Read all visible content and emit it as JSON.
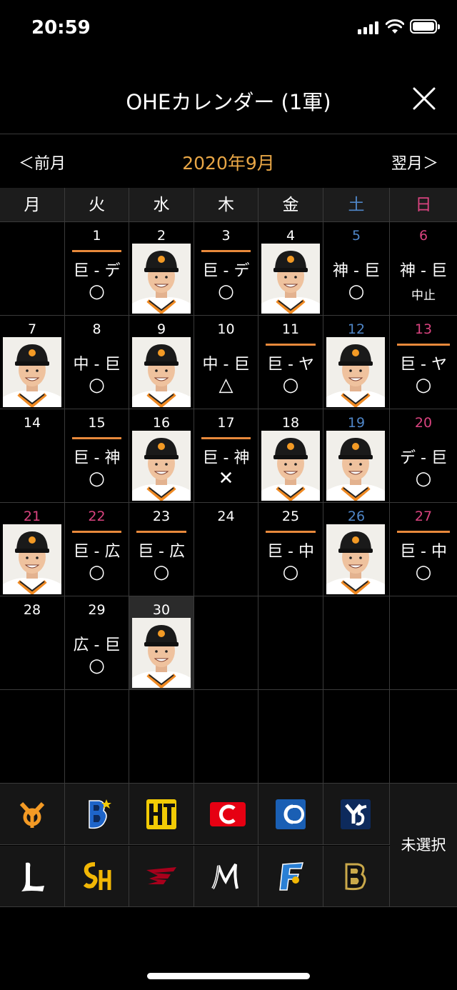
{
  "status": {
    "time": "20:59"
  },
  "header": {
    "title": "OHEカレンダー (1軍)",
    "close_icon": "close-icon"
  },
  "month_nav": {
    "prev": "＜前月",
    "month": "2020年9月",
    "next": "翌月＞"
  },
  "colors": {
    "accent": "#e8a646",
    "bar": "#e8893b",
    "saturday": "#4f86c8",
    "sunday": "#d9437f",
    "grid": "#3a3a3a"
  },
  "weekdays": [
    {
      "label": "月",
      "kind": "weekday"
    },
    {
      "label": "火",
      "kind": "weekday"
    },
    {
      "label": "水",
      "kind": "weekday"
    },
    {
      "label": "木",
      "kind": "weekday"
    },
    {
      "label": "金",
      "kind": "weekday"
    },
    {
      "label": "土",
      "kind": "sat"
    },
    {
      "label": "日",
      "kind": "sun"
    }
  ],
  "weeks": [
    [
      {
        "day": ""
      },
      {
        "day": "1",
        "matchup": "巨 - デ",
        "result": "○",
        "bar": true
      },
      {
        "day": "2",
        "photo": true
      },
      {
        "day": "3",
        "matchup": "巨 - デ",
        "result": "○",
        "bar": true
      },
      {
        "day": "4",
        "photo": true
      },
      {
        "day": "5",
        "kind": "sat",
        "matchup": "神 - 巨",
        "result": "○"
      },
      {
        "day": "6",
        "kind": "sun",
        "matchup": "神 - 巨",
        "result": "中止",
        "cancel": true
      }
    ],
    [
      {
        "day": "7",
        "photo": true
      },
      {
        "day": "8",
        "matchup": "中 - 巨",
        "result": "○"
      },
      {
        "day": "9",
        "photo": true
      },
      {
        "day": "10",
        "matchup": "中 - 巨",
        "result": "△"
      },
      {
        "day": "11",
        "matchup": "巨 - ヤ",
        "result": "○",
        "bar": true
      },
      {
        "day": "12",
        "kind": "sat",
        "photo": true
      },
      {
        "day": "13",
        "kind": "sun",
        "matchup": "巨 - ヤ",
        "result": "○",
        "bar": true
      }
    ],
    [
      {
        "day": "14"
      },
      {
        "day": "15",
        "matchup": "巨 - 神",
        "result": "○",
        "bar": true
      },
      {
        "day": "16",
        "photo": true
      },
      {
        "day": "17",
        "matchup": "巨 - 神",
        "result": "✕",
        "bar": true
      },
      {
        "day": "18",
        "photo": true
      },
      {
        "day": "19",
        "kind": "sat",
        "photo": true
      },
      {
        "day": "20",
        "kind": "sun",
        "matchup": "デ - 巨",
        "result": "○"
      }
    ],
    [
      {
        "day": "21",
        "kind": "sun",
        "photo": true
      },
      {
        "day": "22",
        "kind": "sun",
        "matchup": "巨 - 広",
        "result": "○",
        "bar": true
      },
      {
        "day": "23",
        "matchup": "巨 - 広",
        "result": "○",
        "bar": true
      },
      {
        "day": "24"
      },
      {
        "day": "25",
        "matchup": "巨 - 中",
        "result": "○",
        "bar": true
      },
      {
        "day": "26",
        "kind": "sat",
        "photo": true
      },
      {
        "day": "27",
        "kind": "sun",
        "matchup": "巨 - 中",
        "result": "○",
        "bar": true
      }
    ],
    [
      {
        "day": "28"
      },
      {
        "day": "29",
        "matchup": "広 - 巨",
        "result": "○"
      },
      {
        "day": "30",
        "photo": true,
        "today": true
      },
      {
        "day": ""
      },
      {
        "day": ""
      },
      {
        "day": ""
      },
      {
        "day": ""
      }
    ],
    [
      {
        "day": ""
      },
      {
        "day": ""
      },
      {
        "day": ""
      },
      {
        "day": ""
      },
      {
        "day": ""
      },
      {
        "day": ""
      },
      {
        "day": ""
      }
    ]
  ],
  "teams": [
    [
      {
        "name": "giants-logo",
        "color": "#f39a25"
      },
      {
        "name": "baystars-logo",
        "color": "#1e64c8"
      },
      {
        "name": "tigers-logo",
        "color": "#f2cb05"
      },
      {
        "name": "carp-logo",
        "color": "#e60012"
      },
      {
        "name": "dragons-logo",
        "color": "#1a5fb4"
      },
      {
        "name": "swallows-logo",
        "color": "#0d2a5c"
      }
    ],
    [
      {
        "name": "lions-logo",
        "color": "#ffffff"
      },
      {
        "name": "hawks-logo",
        "color": "#f2b705"
      },
      {
        "name": "eagles-logo",
        "color": "#a8001c"
      },
      {
        "name": "marines-logo",
        "color": "#ffffff"
      },
      {
        "name": "fighters-logo",
        "color": "#2a7fd4"
      },
      {
        "name": "buffaloes-logo",
        "color": "#c9a84a"
      }
    ]
  ],
  "unselected_label": "未選択"
}
